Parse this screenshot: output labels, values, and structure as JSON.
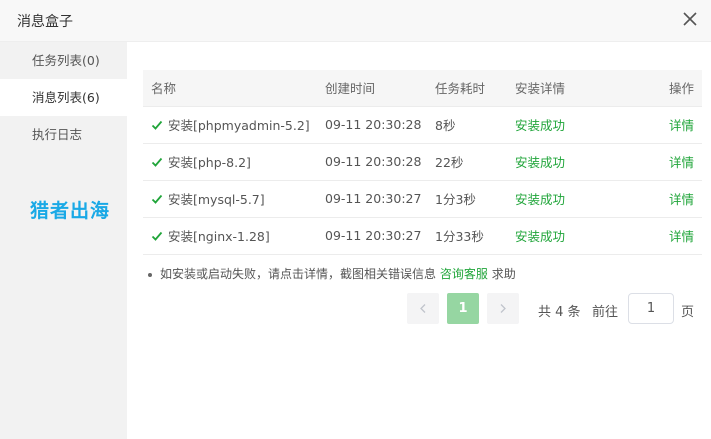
{
  "dialog": {
    "title": "消息盒子",
    "close_icon": "close-icon"
  },
  "sidebar": {
    "items": [
      {
        "label": "任务列表(0)",
        "active": false
      },
      {
        "label": "消息列表(6)",
        "active": true
      },
      {
        "label": "执行日志",
        "active": false
      }
    ]
  },
  "watermark": "猎者出海",
  "table": {
    "headers": [
      "名称",
      "创建时间",
      "任务耗时",
      "安装详情",
      "操作"
    ],
    "rows": [
      {
        "name": "安装[phpmyadmin-5.2]",
        "time": "09-11 20:30:28",
        "duration": "8秒",
        "status": "安装成功",
        "action": "详情"
      },
      {
        "name": "安装[php-8.2]",
        "time": "09-11 20:30:28",
        "duration": "22秒",
        "status": "安装成功",
        "action": "详情"
      },
      {
        "name": "安装[mysql-5.7]",
        "time": "09-11 20:30:27",
        "duration": "1分3秒",
        "status": "安装成功",
        "action": "详情"
      },
      {
        "name": "安装[nginx-1.28]",
        "time": "09-11 20:30:27",
        "duration": "1分33秒",
        "status": "安装成功",
        "action": "详情"
      }
    ]
  },
  "tip": {
    "text": "如安装或启动失败，请点击详情，截图相关错误信息",
    "link": "咨询客服",
    "suffix": "求助"
  },
  "pager": {
    "current": "1",
    "total": "共 4 条",
    "goto": "前往",
    "input_value": "1",
    "page_unit": "页"
  },
  "colors": {
    "accent": "#20a53a",
    "active_page": "#96d6a2",
    "watermark": "#19a9e6"
  }
}
